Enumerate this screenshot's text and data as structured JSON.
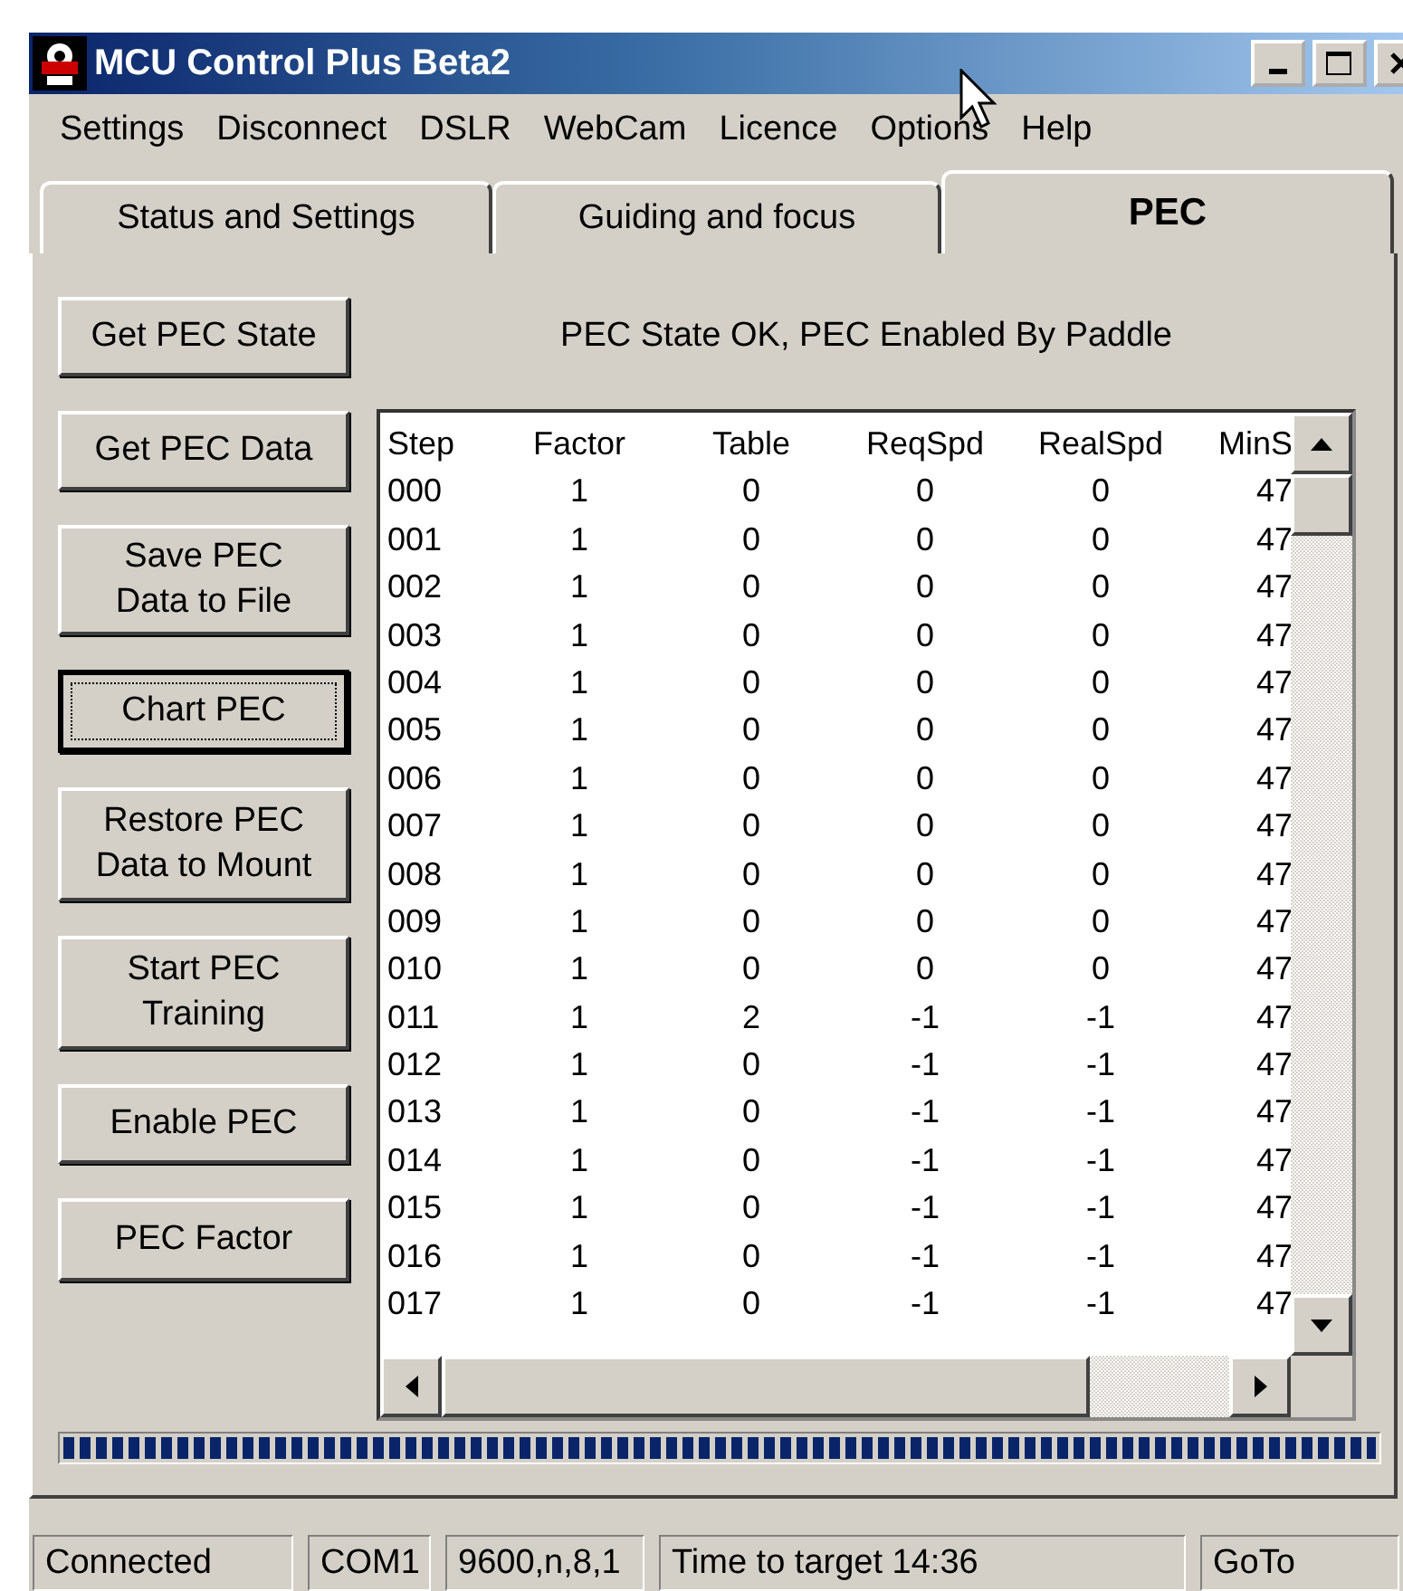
{
  "window": {
    "title": "MCU Control Plus Beta2"
  },
  "menu": [
    "Settings",
    "Disconnect",
    "DSLR",
    "WebCam",
    "Licence",
    "Options",
    "Help"
  ],
  "tabs": [
    {
      "label": "Status and Settings",
      "selected": false
    },
    {
      "label": "Guiding and focus",
      "selected": false
    },
    {
      "label": "PEC",
      "selected": true
    }
  ],
  "buttons": [
    {
      "lines": [
        "Get PEC State"
      ],
      "focused": false
    },
    {
      "lines": [
        "Get PEC Data"
      ],
      "focused": false
    },
    {
      "lines": [
        "Save PEC",
        "Data to File"
      ],
      "focused": false
    },
    {
      "lines": [
        "Chart PEC"
      ],
      "focused": true
    },
    {
      "lines": [
        "Restore PEC",
        "Data to Mount"
      ],
      "focused": false
    },
    {
      "lines": [
        "Start PEC",
        "Training"
      ],
      "focused": false
    },
    {
      "lines": [
        "Enable PEC"
      ],
      "focused": false
    },
    {
      "lines": [
        "PEC Factor"
      ],
      "focused": false
    }
  ],
  "pec_status": "PEC State OK, PEC Enabled By Paddle",
  "table": {
    "columns": [
      "Step",
      "Factor",
      "Table",
      "ReqSpd",
      "RealSpd",
      "MinS"
    ],
    "rows": [
      [
        "000",
        "1",
        "0",
        "0",
        "0",
        "47"
      ],
      [
        "001",
        "1",
        "0",
        "0",
        "0",
        "47"
      ],
      [
        "002",
        "1",
        "0",
        "0",
        "0",
        "47"
      ],
      [
        "003",
        "1",
        "0",
        "0",
        "0",
        "47"
      ],
      [
        "004",
        "1",
        "0",
        "0",
        "0",
        "47"
      ],
      [
        "005",
        "1",
        "0",
        "0",
        "0",
        "47"
      ],
      [
        "006",
        "1",
        "0",
        "0",
        "0",
        "47"
      ],
      [
        "007",
        "1",
        "0",
        "0",
        "0",
        "47"
      ],
      [
        "008",
        "1",
        "0",
        "0",
        "0",
        "47"
      ],
      [
        "009",
        "1",
        "0",
        "0",
        "0",
        "47"
      ],
      [
        "010",
        "1",
        "0",
        "0",
        "0",
        "47"
      ],
      [
        "011",
        "1",
        "2",
        "-1",
        "-1",
        "47"
      ],
      [
        "012",
        "1",
        "0",
        "-1",
        "-1",
        "47"
      ],
      [
        "013",
        "1",
        "0",
        "-1",
        "-1",
        "47"
      ],
      [
        "014",
        "1",
        "0",
        "-1",
        "-1",
        "47"
      ],
      [
        "015",
        "1",
        "0",
        "-1",
        "-1",
        "47"
      ],
      [
        "016",
        "1",
        "0",
        "-1",
        "-1",
        "47"
      ],
      [
        "017",
        "1",
        "0",
        "-1",
        "-1",
        "47"
      ]
    ]
  },
  "progress": {
    "level": 1
  },
  "status_bar": [
    "Connected",
    "COM1",
    "9600,n,8,1",
    "Time to target 14:36",
    "GoTo"
  ]
}
